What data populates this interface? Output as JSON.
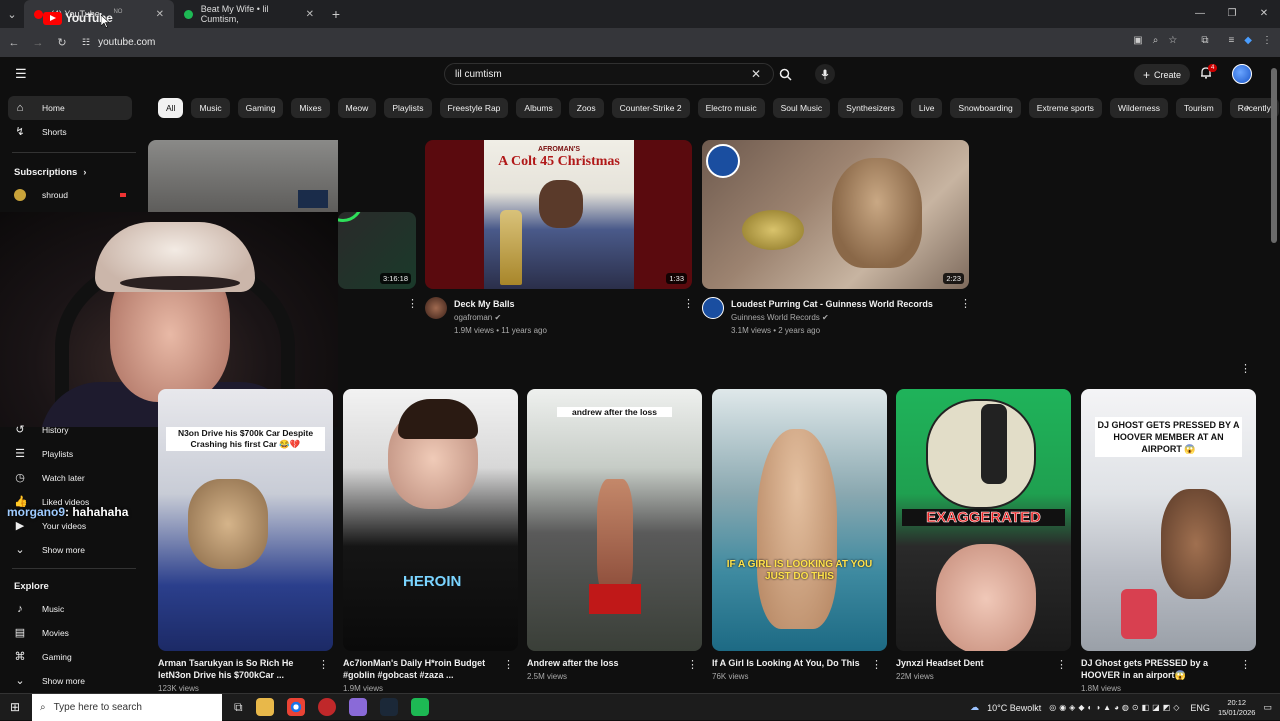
{
  "browser": {
    "tabs": [
      {
        "title": "(4) YouTube",
        "fav_color": "#ff0000"
      },
      {
        "title": "Beat My Wife • lil Cumtism,",
        "fav_color": "#1db954"
      }
    ],
    "url": "youtube.com"
  },
  "header": {
    "logo_text": "YouTube",
    "logo_sup": "NO",
    "search_value": "lil cumtism",
    "create_label": "Create",
    "notif_count": "4"
  },
  "chips": [
    "All",
    "Music",
    "Gaming",
    "Mixes",
    "Meow",
    "Playlists",
    "Freestyle Rap",
    "Albums",
    "Zoos",
    "Counter-Strike 2",
    "Electro music",
    "Soul Music",
    "Synthesizers",
    "Live",
    "Snowboarding",
    "Extreme sports",
    "Wilderness",
    "Tourism",
    "Recently"
  ],
  "sidebar": {
    "home": "Home",
    "shorts": "Shorts",
    "subscriptions": "Subscriptions",
    "sub_item": "shroud",
    "you_items": [
      "History",
      "Playlists",
      "Watch later",
      "Liked videos",
      "Your videos",
      "Show more"
    ],
    "explore": "Explore",
    "explore_items": [
      "Music",
      "Movies",
      "Gaming",
      "Show more"
    ]
  },
  "overlay": {
    "user": "morgano9",
    "msg": ": hahahaha"
  },
  "videos": [
    {
      "title": "",
      "channel": "",
      "meta": "",
      "duration": "3:16:18"
    },
    {
      "title": "Deck My Balls",
      "channel": "ogafroman",
      "meta": "1.9M views • 11 years ago",
      "duration": "1:33",
      "thumb_text": "A Colt 45 Christmas",
      "thumb_top": "AFROMAN'S"
    },
    {
      "title": "Loudest Purring Cat - Guinness World Records",
      "channel": "Guinness World Records",
      "meta": "3.1M views • 2 years ago",
      "duration": "2:23"
    }
  ],
  "shorts": [
    {
      "title1": "Arman Tsarukyan is So Rich He",
      "title2": "letN3on Drive his $700kCar ...",
      "views": "123K views",
      "caption": "N3on Drive his $700k Car Despite Crashing his first Car 😂💔"
    },
    {
      "title1": "Ac7ionMan's Daily H*roin Budget",
      "title2": "#goblin #gobcast #zaza ...",
      "views": "1.9M views",
      "caption": "",
      "shirt": "HEROIN"
    },
    {
      "title1": "Andrew after the loss",
      "title2": "",
      "views": "2.5M views",
      "caption": "andrew after the loss"
    },
    {
      "title1": "If A Girl Is Looking At You, Do This",
      "title2": "",
      "views": "76K views",
      "caption": "IF A GIRL IS LOOKING AT YOU JUST DO THIS"
    },
    {
      "title1": "Jynxzi Headset Dent",
      "title2": "",
      "views": "22M views",
      "caption": "EXAGGERATED"
    },
    {
      "title1": "DJ Ghost gets PRESSED by a",
      "title2": "HOOVER in an airport😱",
      "views": "1.8M views",
      "caption": "DJ GHOST GETS PRESSED BY A HOOVER MEMBER AT AN AIRPORT 😱"
    }
  ],
  "taskbar": {
    "search_placeholder": "Type here to search",
    "weather": "10°C  Bewolkt",
    "lang": "ENG",
    "time": "20:12",
    "date": "15/01/2026"
  }
}
